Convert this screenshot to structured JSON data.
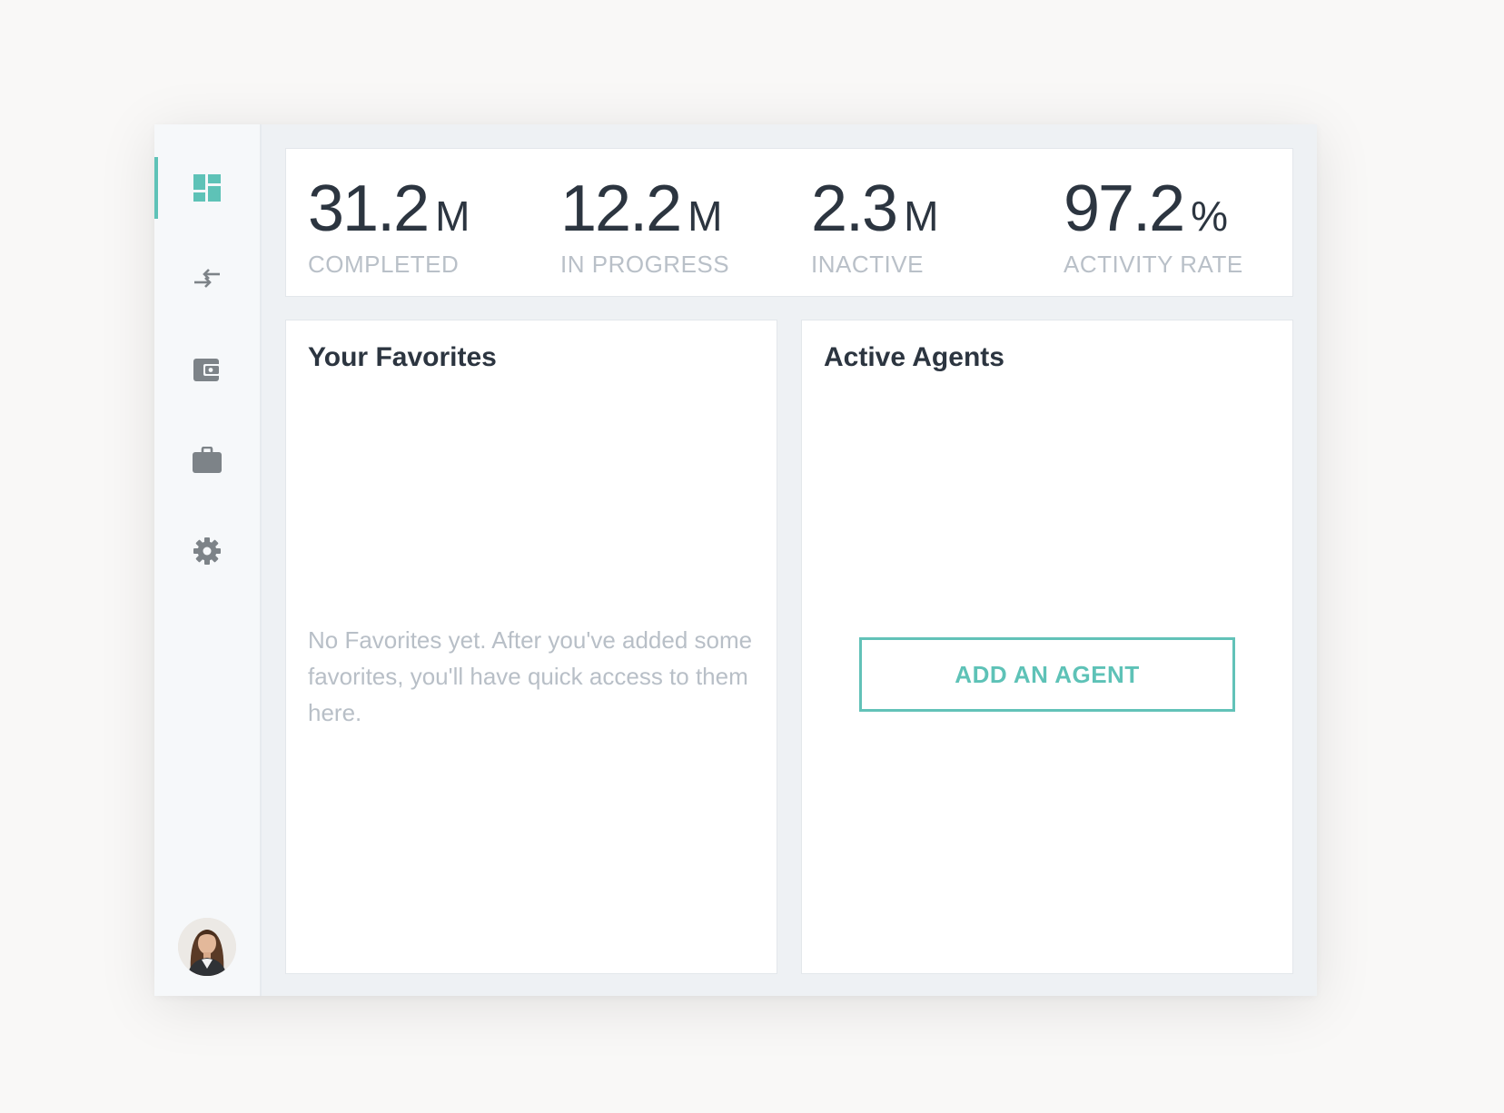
{
  "colors": {
    "accent": "#5ec2b7",
    "text_dark": "#2c3540",
    "text_muted": "#b9c0c8",
    "icon_gray": "#7d8388",
    "background": "#f9f8f7",
    "app_background": "#eef1f4"
  },
  "sidebar": {
    "items": [
      {
        "icon": "dashboard-icon",
        "active": true
      },
      {
        "icon": "transfer-arrows-icon",
        "active": false
      },
      {
        "icon": "wallet-icon",
        "active": false
      },
      {
        "icon": "briefcase-icon",
        "active": false
      },
      {
        "icon": "gear-icon",
        "active": false
      }
    ],
    "avatar": {
      "icon": "user-avatar"
    }
  },
  "stats": [
    {
      "value": "31.2",
      "unit": "M",
      "label": "COMPLETED"
    },
    {
      "value": "12.2",
      "unit": "M",
      "label": "IN PROGRESS"
    },
    {
      "value": "2.3",
      "unit": "M",
      "label": "INACTIVE"
    },
    {
      "value": "97.2",
      "unit": "%",
      "label": "ACTIVITY RATE"
    }
  ],
  "favorites": {
    "title": "Your Favorites",
    "empty_text": "No Favorites yet. After you've added some favorites, you'll have quick access to them here."
  },
  "agents": {
    "title": "Active Agents",
    "add_button_label": "ADD AN AGENT"
  }
}
